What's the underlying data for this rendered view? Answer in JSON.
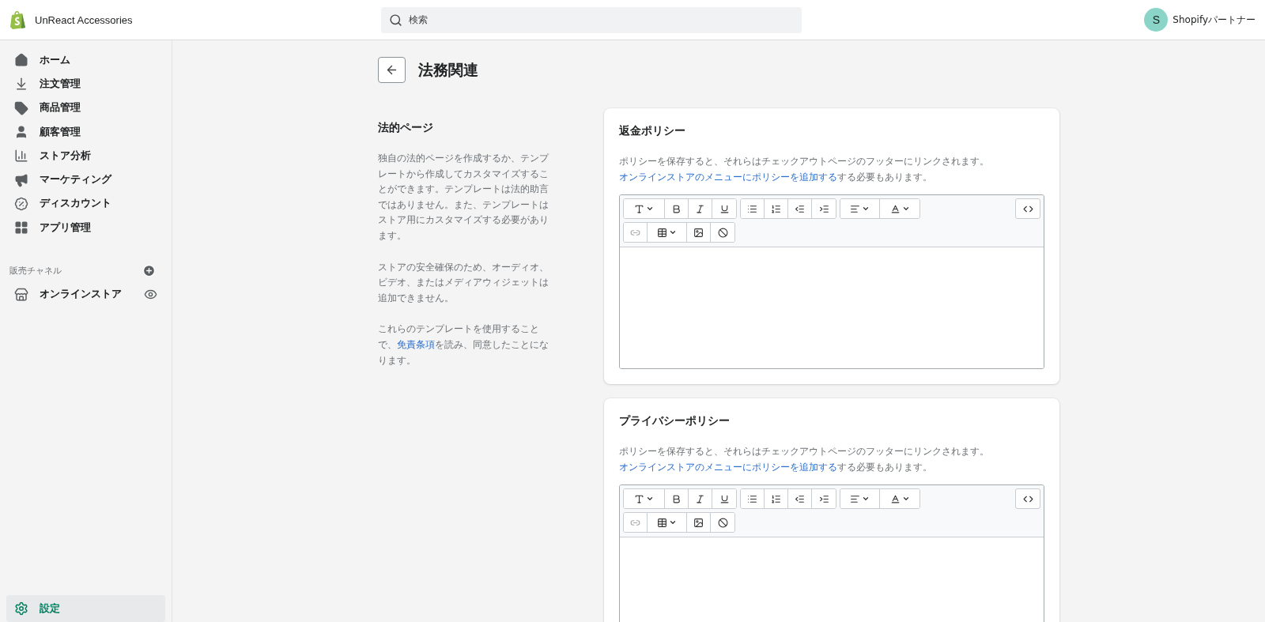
{
  "topbar": {
    "store_name": "UnReact Accessories",
    "search": {
      "placeholder": "検索"
    },
    "account": {
      "initial": "S",
      "name": "Shopifyパートナー"
    }
  },
  "sidebar": {
    "items": [
      {
        "kind": "home",
        "label": "ホーム",
        "selected": false
      },
      {
        "kind": "orders",
        "label": "注文管理",
        "selected": false
      },
      {
        "kind": "products",
        "label": "商品管理",
        "selected": false
      },
      {
        "kind": "customers",
        "label": "顧客管理",
        "selected": false
      },
      {
        "kind": "analytics",
        "label": "ストア分析",
        "selected": false
      },
      {
        "kind": "marketing",
        "label": "マーケティング",
        "selected": false
      },
      {
        "kind": "discounts",
        "label": "ディスカウント",
        "selected": false
      },
      {
        "kind": "apps",
        "label": "アプリ管理",
        "selected": false
      }
    ],
    "channels_heading": "販売チャネル",
    "channels": [
      {
        "kind": "store",
        "label": "オンラインストア",
        "selected": false
      }
    ],
    "settings": {
      "label": "設定",
      "selected": true
    }
  },
  "page": {
    "title": "法務関連",
    "section": {
      "title": "法的ページ",
      "paragraphs": [
        {
          "text": "独自の法的ページを作成するか、テンプレートから作成してカスタマイズすることができます。テンプレートは法的助言ではありません。また、テンプレートはストア用にカスタマイズする必要があります。"
        },
        {
          "text": "ストアの安全確保のため、オーディオ、ビデオ、またはメディアウィジェットは追加できません。"
        },
        {
          "text": "これらのテンプレートを使用することで、",
          "link": "免責条項",
          "after": "を読み、同意したことになります。"
        }
      ]
    },
    "policies": [
      {
        "title": "返金ポリシー",
        "description": "ポリシーを保存すると、それらはチェックアウトページのフッターにリンクされます。",
        "link": "オンラインストアのメニューにポリシーを追加する",
        "after": "する必要もあります。"
      },
      {
        "title": "プライバシーポリシー",
        "description": "ポリシーを保存すると、それらはチェックアウトページのフッターにリンクされます。",
        "link": "オンラインストアのメニューにポリシーを追加する",
        "after": "する必要もあります。"
      }
    ]
  }
}
